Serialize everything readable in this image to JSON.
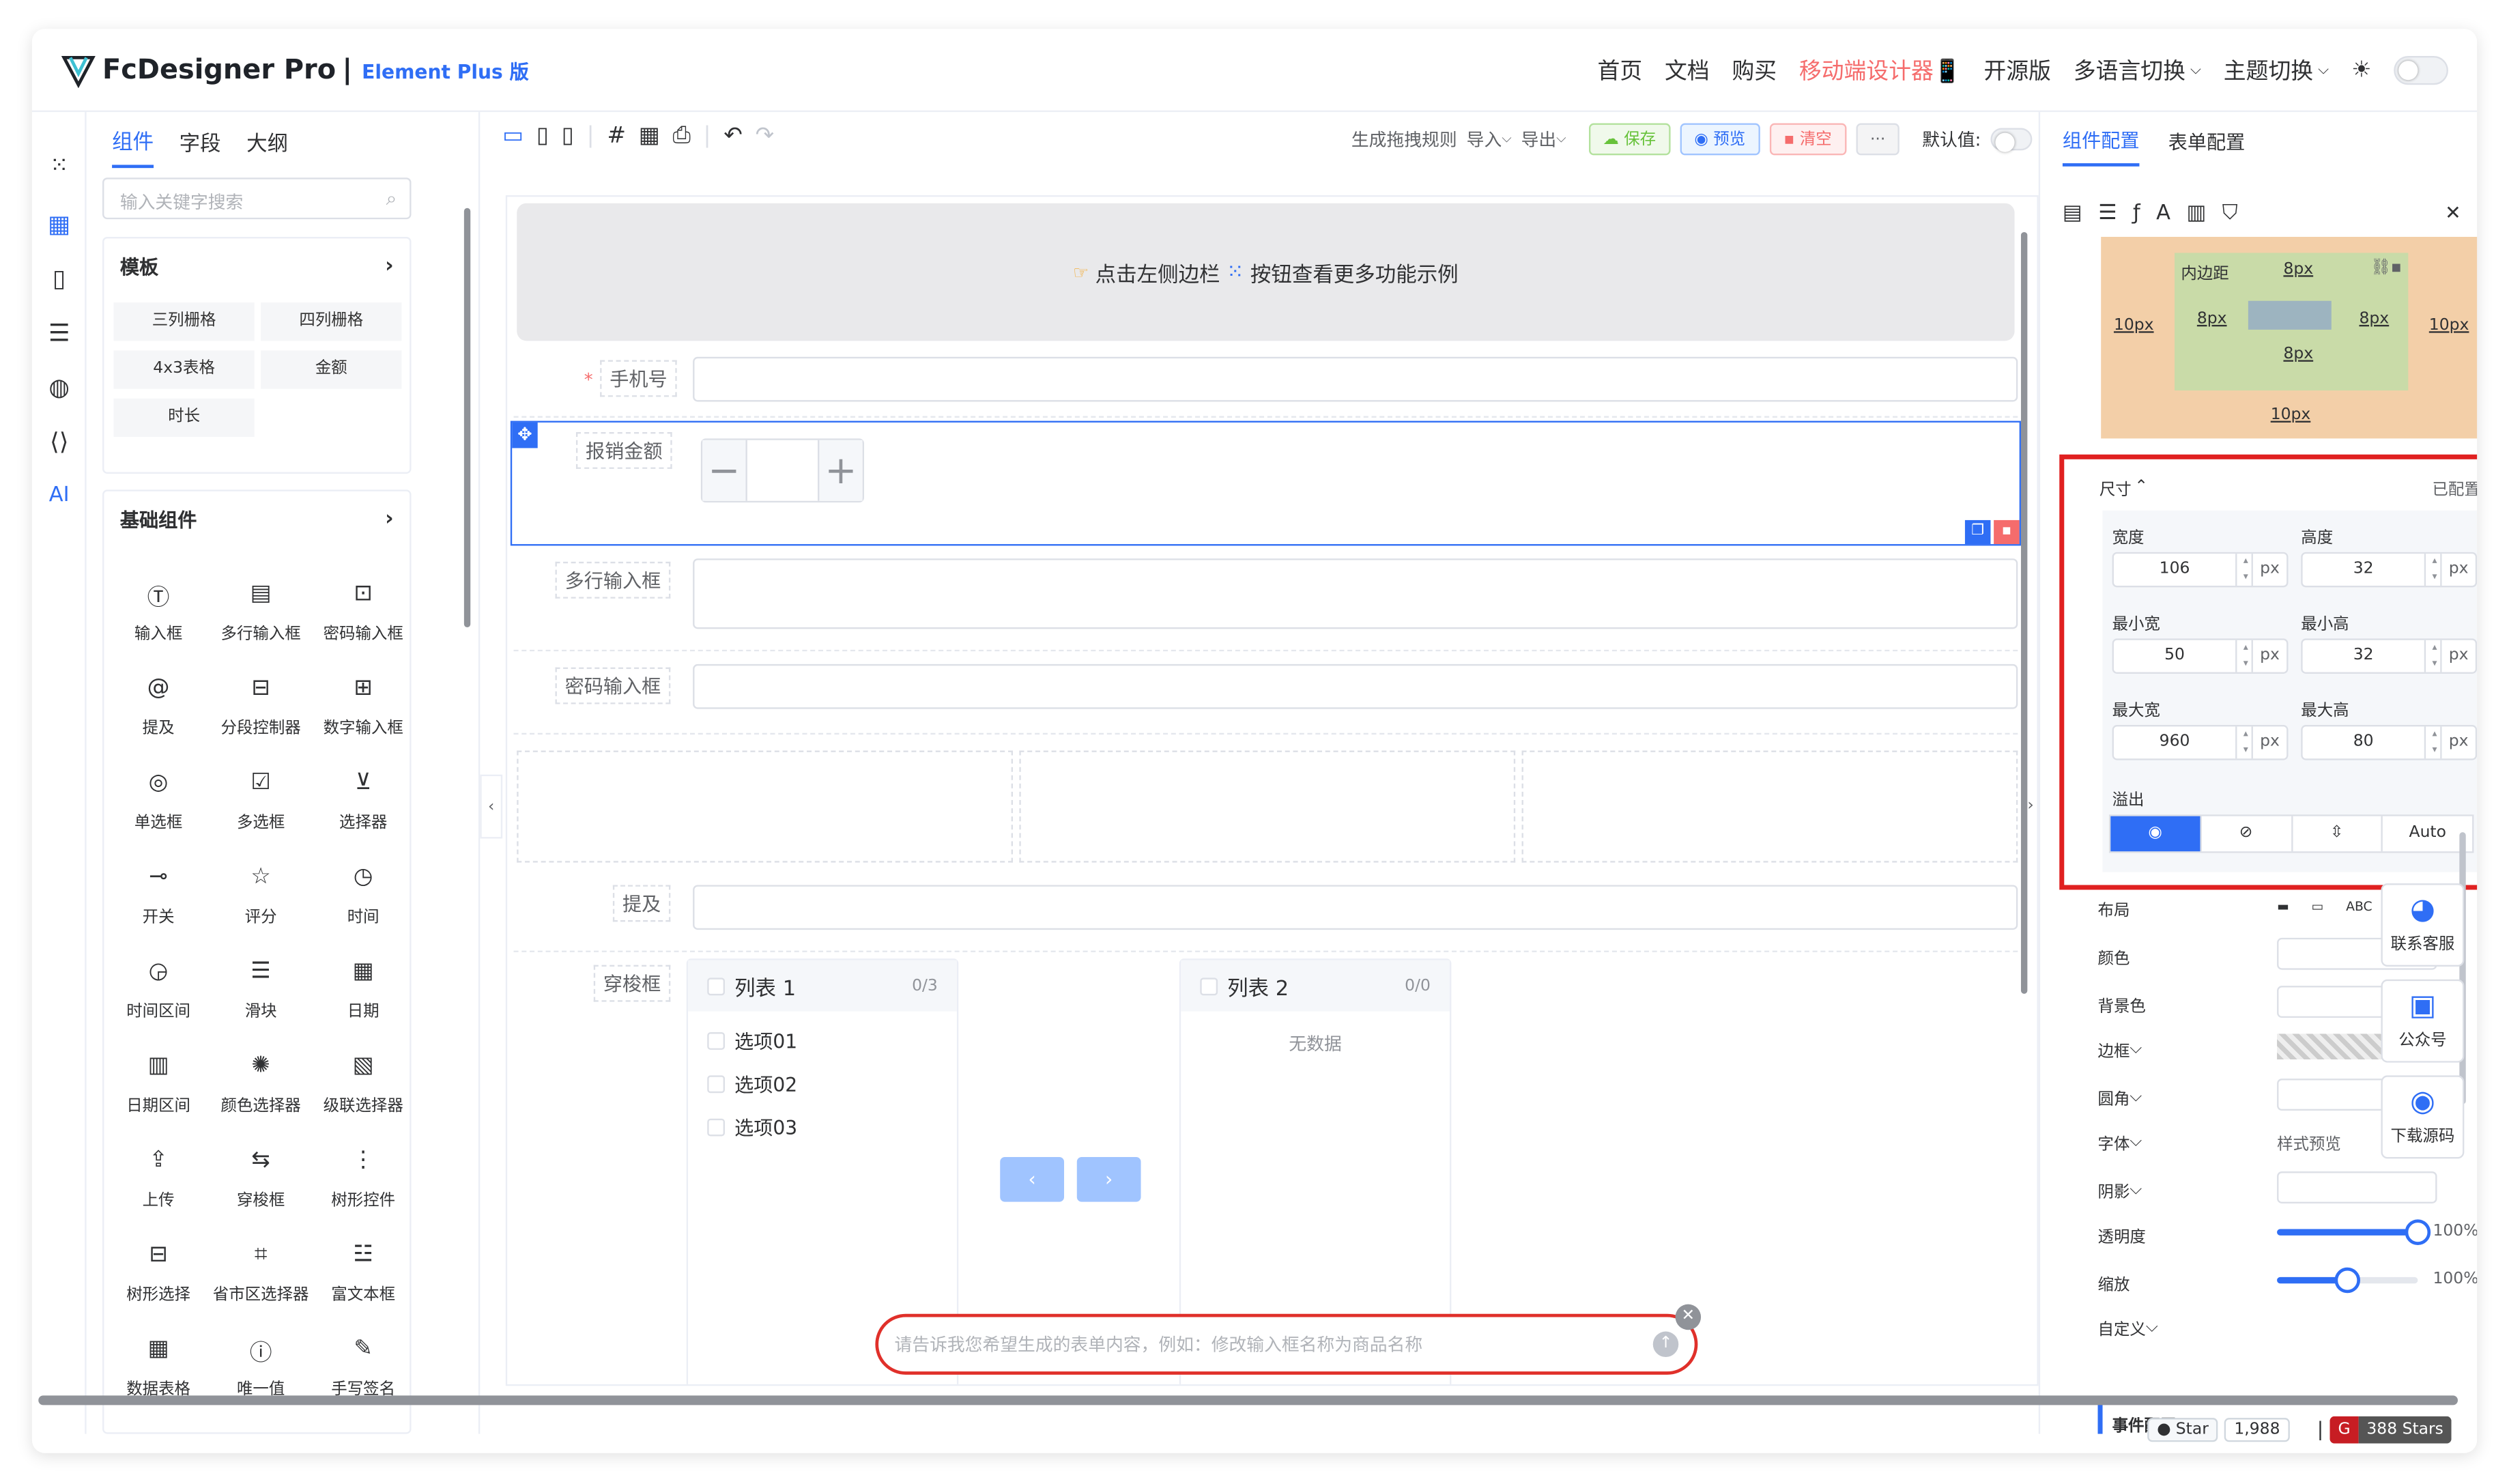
{
  "header": {
    "app_name": "FcDesigner Pro",
    "separator": "|",
    "version_tag": "Element Plus 版",
    "nav": [
      "首页",
      "文档",
      "购买",
      "移动端设计器📱",
      "开源版",
      "多语言切换",
      "主题切换"
    ]
  },
  "left_panel": {
    "tabs": [
      "组件",
      "字段",
      "大纲"
    ],
    "search_placeholder": "输入关键字搜索",
    "template_title": "模板",
    "templates": [
      "三列栅格",
      "四列栅格",
      "4x3表格",
      "金额",
      "时长"
    ],
    "basic_title": "基础组件",
    "components": [
      {
        "label": "输入框",
        "icon": "input-icon"
      },
      {
        "label": "多行输入框",
        "icon": "textarea-icon"
      },
      {
        "label": "密码输入框",
        "icon": "password-icon"
      },
      {
        "label": "提及",
        "icon": "mention-icon"
      },
      {
        "label": "分段控制器",
        "icon": "segmented-icon"
      },
      {
        "label": "数字输入框",
        "icon": "number-icon"
      },
      {
        "label": "单选框",
        "icon": "radio-icon"
      },
      {
        "label": "多选框",
        "icon": "checkbox-icon"
      },
      {
        "label": "选择器",
        "icon": "select-icon"
      },
      {
        "label": "开关",
        "icon": "switch-icon"
      },
      {
        "label": "评分",
        "icon": "star-icon"
      },
      {
        "label": "时间",
        "icon": "clock-icon"
      },
      {
        "label": "时间区间",
        "icon": "time-range-icon"
      },
      {
        "label": "滑块",
        "icon": "slider-icon"
      },
      {
        "label": "日期",
        "icon": "calendar-icon"
      },
      {
        "label": "日期区间",
        "icon": "date-range-icon"
      },
      {
        "label": "颜色选择器",
        "icon": "palette-icon"
      },
      {
        "label": "级联选择器",
        "icon": "cascader-icon"
      },
      {
        "label": "上传",
        "icon": "upload-icon"
      },
      {
        "label": "穿梭框",
        "icon": "transfer-icon"
      },
      {
        "label": "树形控件",
        "icon": "tree-icon"
      },
      {
        "label": "树形选择",
        "icon": "tree-select-icon"
      },
      {
        "label": "省市区选择器",
        "icon": "region-icon"
      },
      {
        "label": "富文本框",
        "icon": "rich-text-icon"
      },
      {
        "label": "数据表格",
        "icon": "table-icon"
      },
      {
        "label": "唯一值",
        "icon": "id-icon"
      },
      {
        "label": "手写签名",
        "icon": "signature-icon"
      }
    ]
  },
  "toolbar": {
    "generate": "生成拖拽规则",
    "import": "导入",
    "export": "导出",
    "save": "保存",
    "preview": "预览",
    "clear": "清空",
    "more": "···",
    "default_label": "默认值:"
  },
  "canvas": {
    "banner": "点击左侧边栏",
    "banner_suffix": "按钮查看更多功能示例",
    "fields": {
      "phone": "手机号",
      "amount": "报销金额",
      "amount_minus": "−",
      "amount_plus": "+",
      "textarea": "多行输入框",
      "password": "密码输入框",
      "mention": "提及",
      "transfer": "穿梭框"
    },
    "required_mark": "*",
    "transfer": {
      "left_title": "列表 1",
      "left_count": "0/3",
      "left_items": [
        "选项01",
        "选项02",
        "选项03"
      ],
      "right_title": "列表 2",
      "right_count": "0/0",
      "right_empty": "无数据"
    },
    "ai_placeholder": "请告诉我您希望生成的表单内容，例如：修改输入框名称为商品名称"
  },
  "right_panel": {
    "tabs": [
      "组件配置",
      "表单配置"
    ],
    "padding_label": "内边距",
    "margin_value": "10px",
    "padding_value": "8px",
    "size_title": "尺寸",
    "configured": "已配置",
    "width_label": "宽度",
    "height_label": "高度",
    "min_width_label": "最小宽",
    "min_height_label": "最小高",
    "max_width_label": "最大宽",
    "max_height_label": "最大高",
    "width": "106",
    "height": "32",
    "min_width": "50",
    "min_height": "32",
    "max_width": "960",
    "max_height": "80",
    "unit": "px",
    "overflow_label": "溢出",
    "overflow_auto": "Auto",
    "props": {
      "layout": "布局",
      "color": "颜色",
      "bg": "背景色",
      "border": "边框",
      "radius": "圆角",
      "font": "字体",
      "font_preview": "样式预览",
      "shadow": "阴影",
      "opacity": "透明度",
      "opacity_value": "100%",
      "scale": "缩放",
      "scale_value": "100%",
      "custom": "自定义",
      "event": "事件配置"
    },
    "abc": "ABC",
    "opacity_fraction": 1.0,
    "scale_fraction": 0.5
  },
  "float": {
    "service": "联系客服",
    "official": "公众号",
    "source": "下载源码"
  },
  "footer": {
    "star": "Star",
    "star_count": "1,988",
    "gitee": "388 Stars"
  },
  "colors": {
    "primary": "#2f6ef5",
    "danger": "#f56c6c",
    "success": "#67c23a",
    "highlight": "#e02020",
    "ai_border": "#f5a623",
    "margin_bg": "#f3cfa8",
    "padding_bg": "#c9dba8",
    "content_bg": "#9db4c0"
  }
}
